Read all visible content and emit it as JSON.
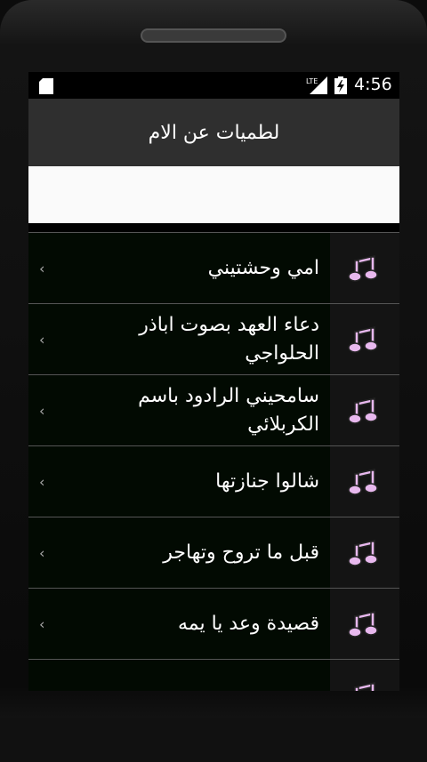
{
  "status_bar": {
    "time": "4:56",
    "network_label": "LTE"
  },
  "app_bar": {
    "title": "لطميات عن الام"
  },
  "list": [
    {
      "title": "امي وحشتيني"
    },
    {
      "title": "دعاء العهد بصوت اباذر الحلواجي"
    },
    {
      "title": "سامحيني الرادود باسم الكربلائي"
    },
    {
      "title": "شالوا جنازتها"
    },
    {
      "title": "قبل ما تروح وتهاجر"
    },
    {
      "title": "قصيدة وعد يا يمه"
    },
    {
      "title": ""
    }
  ],
  "colors": {
    "icon": "#e8b8ee",
    "app_bar": "#2f2f2f",
    "list_bg": "#020a02"
  },
  "icons": {
    "item": "music-note-icon",
    "chevron": "chevron-left-icon"
  }
}
